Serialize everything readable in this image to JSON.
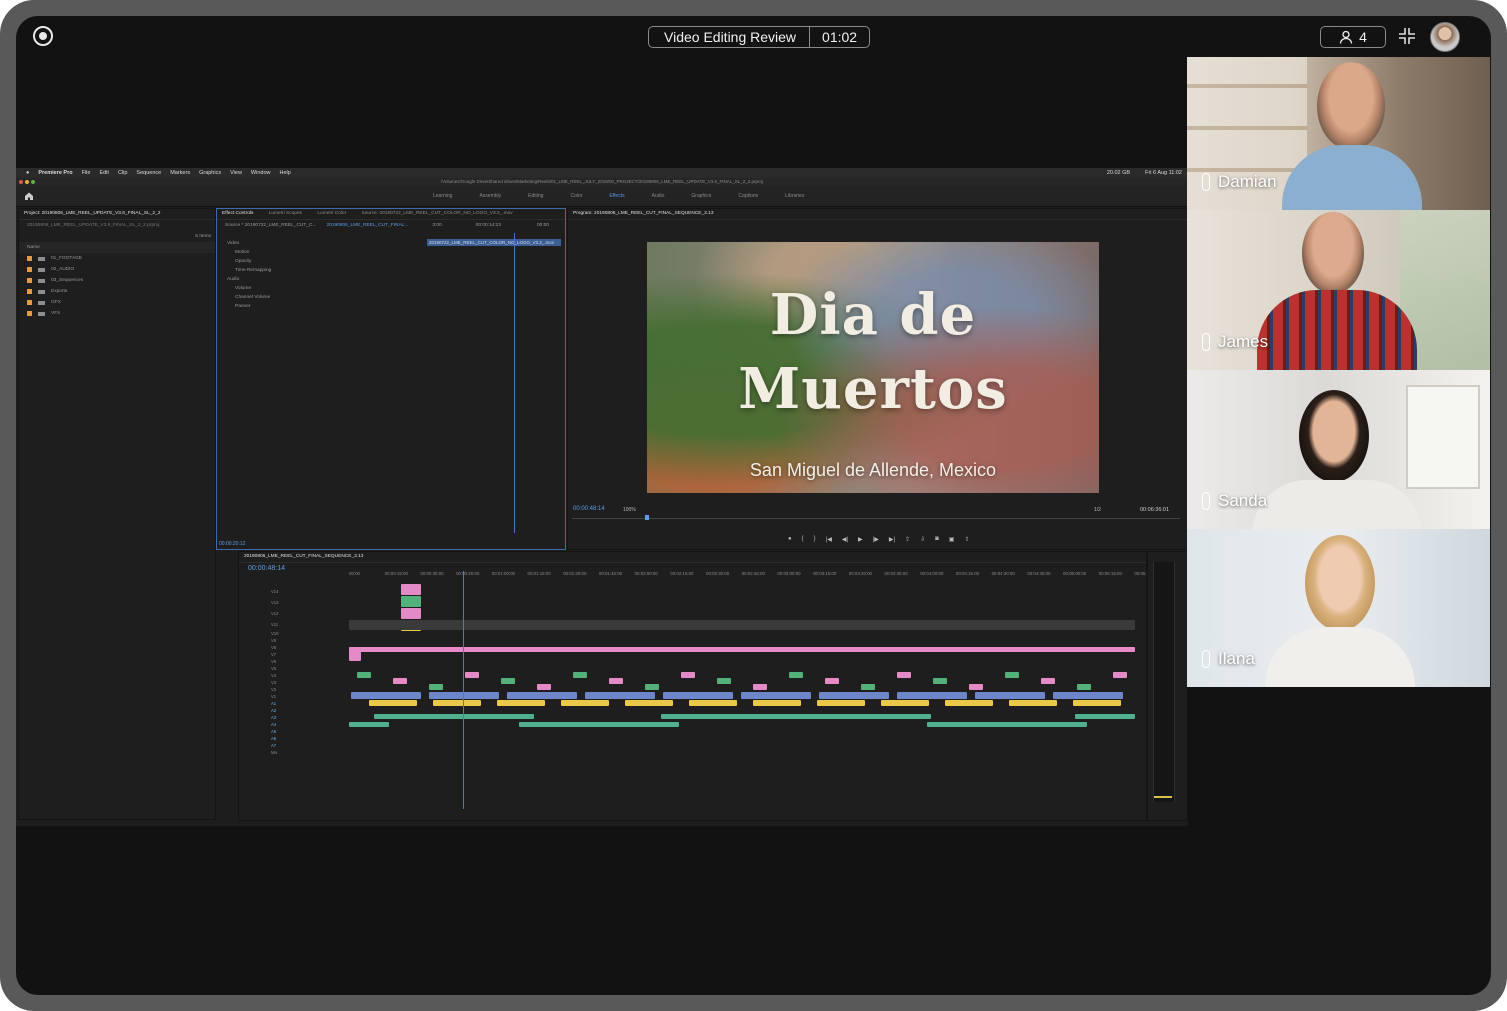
{
  "meeting": {
    "title": "Video Editing Review",
    "timer": "01:02",
    "participant_count": "4"
  },
  "participants": [
    {
      "name": "Damian"
    },
    {
      "name": "James"
    },
    {
      "name": "Sanda"
    },
    {
      "name": "Ilana"
    }
  ],
  "premiere": {
    "menubar": [
      "Premiere Pro",
      "File",
      "Edit",
      "Clip",
      "Sequence",
      "Markers",
      "Graphics",
      "View",
      "Window",
      "Help"
    ],
    "status_right": "Fri 6 Aug  11:02",
    "storage": "20.02 GB",
    "path": "/Volumes/Google Drive/Shared drives/Marketing/Reels/01_LME_REEL_JULY_2019/00_PROJECT/20190806_LME_REEL_UPDATE_V3.6_FINAL_SL_2_2.prproj",
    "workspaces": [
      "Learning",
      "Assembly",
      "Editing",
      "Color",
      "Effects",
      "Audio",
      "Graphics",
      "Captions",
      "Libraries"
    ],
    "active_workspace": "Effects",
    "project": {
      "tab": "Project: 20190806_LME_REEL_UPDATE_V3.6_FINAL_SL_2_2",
      "file": "20190806_LME_REEL_UPDATE_V3.6_FINAL_SL_2_2.prproj",
      "items_count": "6 Items",
      "column_name": "Name",
      "bins": [
        "01_FOOTAGE",
        "02_AUDIO",
        "03_Sequences",
        "Exports",
        "GFX",
        "VFX"
      ]
    },
    "effect_controls": {
      "tabs": [
        "Effect Controls",
        "Lumetri Scopes",
        "Lumetri Color",
        "Source: 20190722_LME_REEL_CUT_COLOR_NO_LOGO_V3.2_.mov"
      ],
      "source": "Source * 20190722_LME_REEL_CUT_C...",
      "sequence": "20190806_LME_REEL_CUT_FINAL...",
      "clip": "20190722_LME_REEL_CUT_COLOR_NO_LOGO_V3.2_.mov",
      "time_start": "3:00",
      "time_mid": "00:00:14:23",
      "time_end": "00:00",
      "sections": [
        "Video",
        "Motion",
        "Opacity",
        "Time Remapping",
        "Audio",
        "Volume",
        "Channel Volume",
        "Panner"
      ],
      "timecode": "00:00:20:12"
    },
    "program": {
      "tab": "Program: 20190806_LME_REEL_CUT_FINAL_SEQUENCE_3.13",
      "title_line1": "Dia de",
      "title_line2": "Muertos",
      "subtitle": "San Miguel de Allende, Mexico",
      "timecode": "00:00:48:14",
      "zoom": "100%",
      "resolution": "1/2",
      "duration": "00:06:36:01"
    },
    "timeline": {
      "tab": "20190806_LME_REEL_CUT_FINAL_SEQUENCE_3.13",
      "timecode": "00:00:48:14",
      "ruler": [
        "00:00",
        "00:00:15:00",
        "00:00:30:00",
        "00:00:45:00",
        "00:01:00:00",
        "00:01:15:00",
        "00:01:30:00",
        "00:01:45:00",
        "00:02:00:00",
        "00:02:15:00",
        "00:02:30:00",
        "00:02:45:00",
        "00:03:00:00",
        "00:03:15:00",
        "00:03:30:00",
        "00:03:45:00",
        "00:04:00:00",
        "00:04:15:00",
        "00:04:30:00",
        "00:04:45:00",
        "00:05:00:00",
        "00:05:15:00",
        "00:05:30:00"
      ],
      "video_tracks": [
        "V14",
        "V13",
        "V12",
        "V11",
        "V10",
        "V9",
        "V8",
        "V7",
        "V6",
        "V5",
        "V4",
        "V3",
        "V2",
        "V1"
      ],
      "audio_tracks": [
        "A1",
        "A2",
        "A3",
        "A4",
        "A5",
        "A6",
        "A7",
        "Mix"
      ],
      "mix_value": "0.0"
    }
  },
  "colors": {
    "accent_blue": "#5a9ee6",
    "clip_pink": "#e38ac7",
    "clip_green": "#52b27a",
    "clip_yellow": "#e9c84a",
    "clip_blue": "#6d86c9",
    "clip_teal": "#4fb08f"
  }
}
